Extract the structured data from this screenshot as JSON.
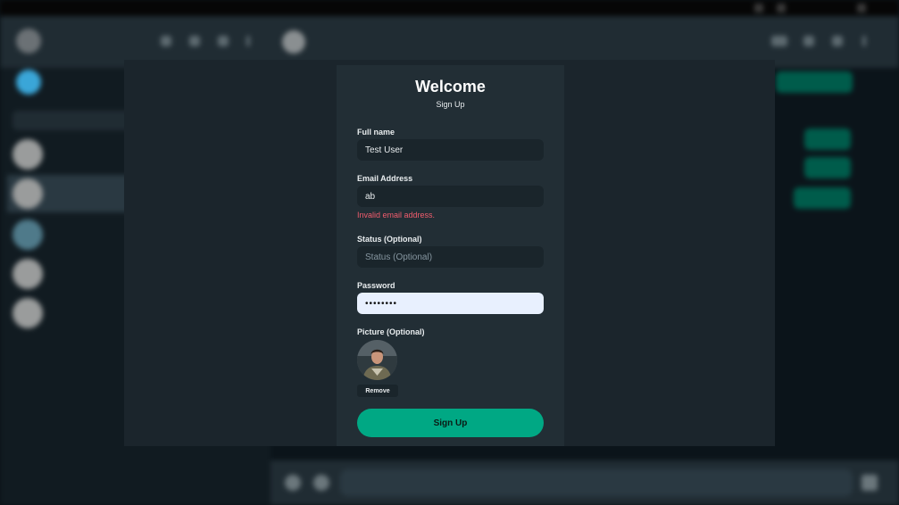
{
  "modal": {
    "title": "Welcome",
    "subtitle": "Sign Up",
    "fields": {
      "full_name": {
        "label": "Full name",
        "value": "Test User"
      },
      "email": {
        "label": "Email Address",
        "value": "ab",
        "error": "Invalid email address."
      },
      "status": {
        "label": "Status (Optional)",
        "value": "",
        "placeholder": "Status (Optional)"
      },
      "password": {
        "label": "Password",
        "value": "••••••••"
      },
      "picture": {
        "label": "Picture (Optional)",
        "remove_label": "Remove"
      }
    },
    "submit_label": "Sign Up"
  },
  "colors": {
    "accent": "#00a884",
    "error": "#f15c6d",
    "modal_bg": "#222e35",
    "input_bg": "#1a252b"
  }
}
